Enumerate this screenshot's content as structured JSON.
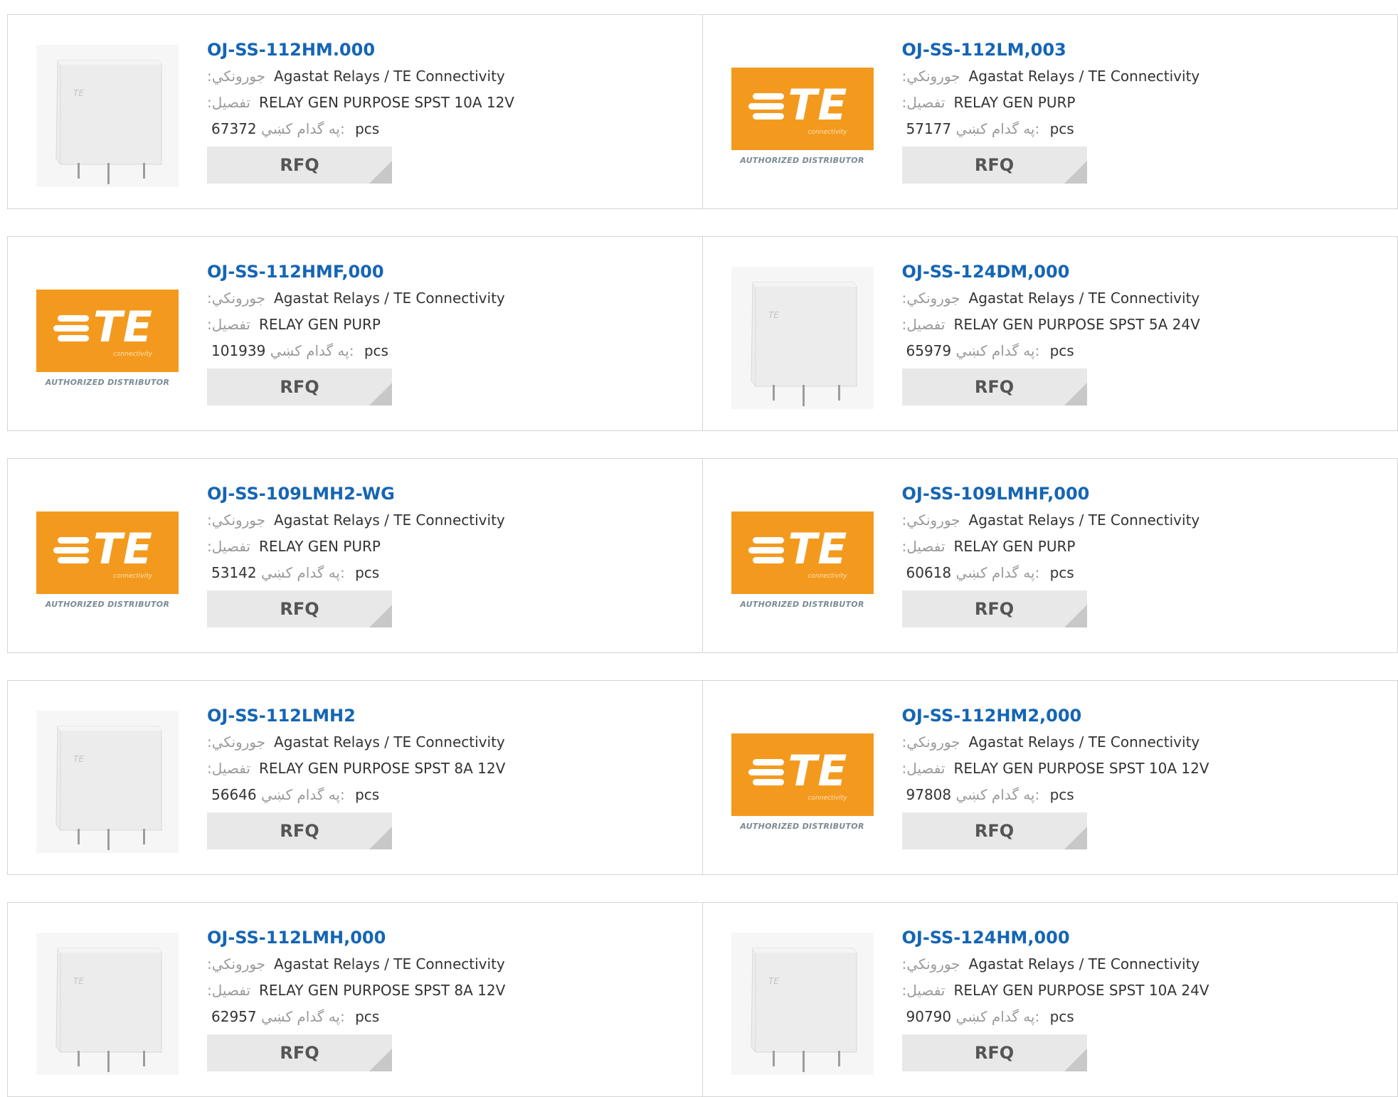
{
  "labels": {
    "manufacturer": ":جورونكي",
    "description": ":تفصيل",
    "stock": "په گدام کښي:",
    "pcs": "pcs",
    "rfq": "RFQ"
  },
  "logo": {
    "brand": "TE",
    "sub": "connectivity",
    "caption": "AUTHORIZED DISTRIBUTOR"
  },
  "relay_mark": "TE",
  "colors": {
    "link": "#1565b4",
    "te_orange": "#f39a1e",
    "rfq_bg": "#e8e8e8"
  },
  "products": [
    {
      "part": "OJ-SS-112HM.000",
      "manufacturer": "Agastat Relays / TE Connectivity",
      "description": "RELAY GEN PURPOSE SPST 10A 12V",
      "stock": "67372",
      "image": "relay"
    },
    {
      "part": "OJ-SS-112LM,003",
      "manufacturer": "Agastat Relays / TE Connectivity",
      "description": "RELAY GEN PURP",
      "stock": "57177",
      "image": "te-logo"
    },
    {
      "part": "OJ-SS-112HMF,000",
      "manufacturer": "Agastat Relays / TE Connectivity",
      "description": "RELAY GEN PURP",
      "stock": "101939",
      "image": "te-logo"
    },
    {
      "part": "OJ-SS-124DM,000",
      "manufacturer": "Agastat Relays / TE Connectivity",
      "description": "RELAY GEN PURPOSE SPST 5A 24V",
      "stock": "65979",
      "image": "relay"
    },
    {
      "part": "OJ-SS-109LMH2-WG",
      "manufacturer": "Agastat Relays / TE Connectivity",
      "description": "RELAY GEN PURP",
      "stock": "53142",
      "image": "te-logo"
    },
    {
      "part": "OJ-SS-109LMHF,000",
      "manufacturer": "Agastat Relays / TE Connectivity",
      "description": "RELAY GEN PURP",
      "stock": "60618",
      "image": "te-logo"
    },
    {
      "part": "OJ-SS-112LMH2",
      "manufacturer": "Agastat Relays / TE Connectivity",
      "description": "RELAY GEN PURPOSE SPST 8A 12V",
      "stock": "56646",
      "image": "relay"
    },
    {
      "part": "OJ-SS-112HM2,000",
      "manufacturer": "Agastat Relays / TE Connectivity",
      "description": "RELAY GEN PURPOSE SPST 10A 12V",
      "stock": "97808",
      "image": "te-logo"
    },
    {
      "part": "OJ-SS-112LMH,000",
      "manufacturer": "Agastat Relays / TE Connectivity",
      "description": "RELAY GEN PURPOSE SPST 8A 12V",
      "stock": "62957",
      "image": "relay"
    },
    {
      "part": "OJ-SS-124HM,000",
      "manufacturer": "Agastat Relays / TE Connectivity",
      "description": "RELAY GEN PURPOSE SPST 10A 24V",
      "stock": "90790",
      "image": "relay"
    }
  ]
}
